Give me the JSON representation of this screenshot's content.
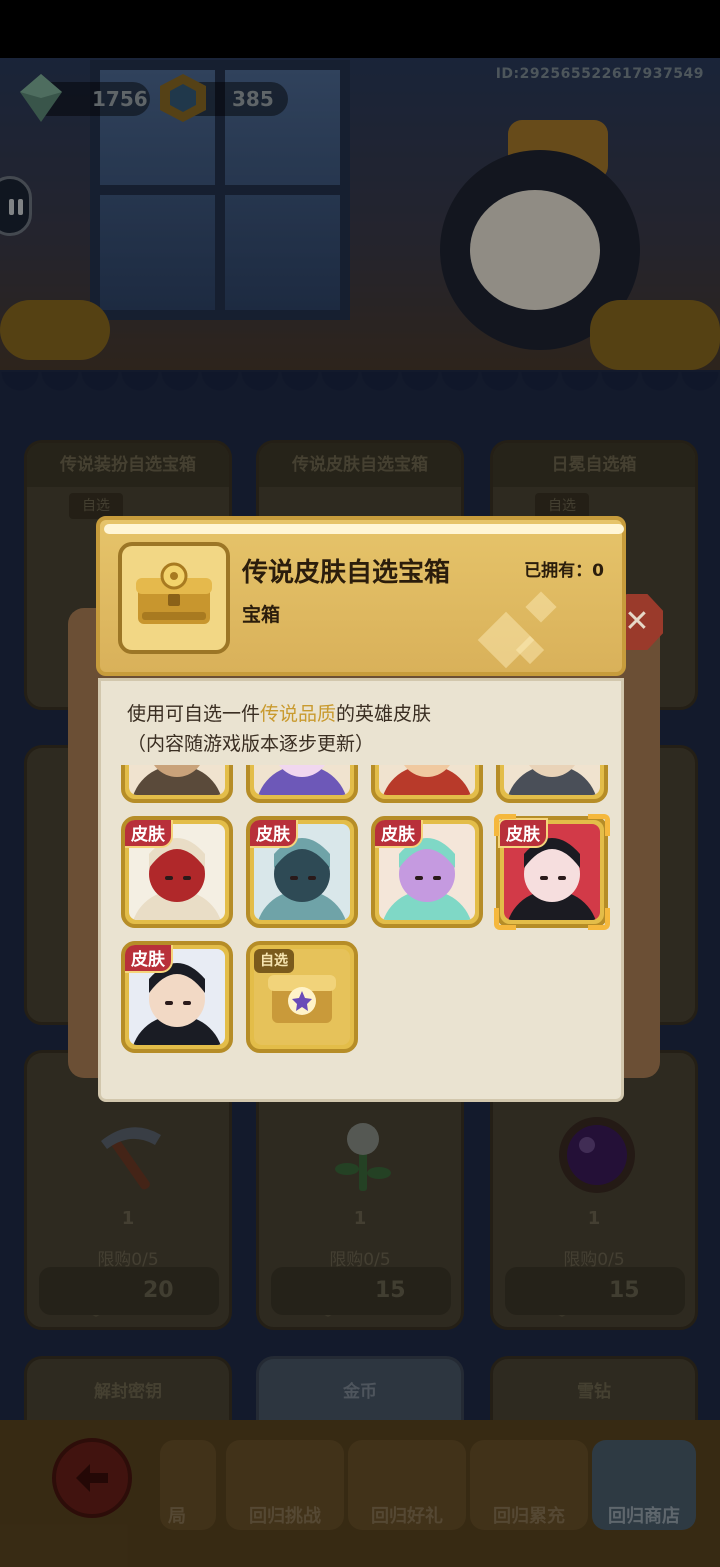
{
  "status": {
    "gems": "1756",
    "cubes": "385",
    "player_id": "ID:2925655226179375​49"
  },
  "shop": {
    "cards": [
      {
        "title": "传说装扮自选宝箱",
        "tag": "自选"
      },
      {
        "title": "传说皮肤自选宝箱",
        "tag": ""
      },
      {
        "title": "日冕自选箱",
        "tag": "自选"
      }
    ],
    "buy_items": [
      {
        "qty": "1",
        "limit": "限购0/5",
        "price": "20",
        "icon": "pickaxe-icon"
      },
      {
        "qty": "1",
        "limit": "限购0/5",
        "price": "15",
        "icon": "plant-icon"
      },
      {
        "qty": "1",
        "limit": "限购0/5",
        "price": "15",
        "icon": "purple-orb-icon"
      }
    ],
    "section_headers": [
      "解封密钥",
      "金币",
      "雪钻"
    ]
  },
  "bottom_nav": {
    "partial_label": "局",
    "items": [
      "回归挑战",
      "回归好礼",
      "回归累充",
      "回归商店"
    ]
  },
  "modal": {
    "title": "传说皮肤自选宝箱",
    "subtitle": "宝箱",
    "owned_label": "已拥有：",
    "owned_count": "0",
    "desc_prefix": "使用可自选一件",
    "desc_highlight": "传说品质",
    "desc_suffix": "的英雄皮肤",
    "desc_line2": "（内容随游戏版本逐步更新）",
    "skin_tag": "皮肤",
    "pick_tag": "自选",
    "tiles": [
      {
        "kind": "partial",
        "palette": [
          "#5a4a3a",
          "#c9a27a"
        ]
      },
      {
        "kind": "partial",
        "palette": [
          "#6d58b8",
          "#f1d7ef"
        ]
      },
      {
        "kind": "partial",
        "palette": [
          "#b83a2a",
          "#f0c9a0"
        ]
      },
      {
        "kind": "partial",
        "palette": [
          "#4a4f58",
          "#e9d3b8"
        ]
      },
      {
        "kind": "skin",
        "name": "monkey-king-skin",
        "palette": [
          "#e9ddc6",
          "#b0282a",
          "#f4efe3"
        ]
      },
      {
        "kind": "skin",
        "name": "armored-dragon-skin",
        "palette": [
          "#6fa3a8",
          "#2e4a55",
          "#d9e7ea"
        ]
      },
      {
        "kind": "skin",
        "name": "teal-hair-girl-skin",
        "palette": [
          "#7fd8c6",
          "#c59ae0",
          "#f4e6d9"
        ]
      },
      {
        "kind": "skin",
        "name": "black-hair-shrine-skin",
        "palette": [
          "#1b1b22",
          "#f6dede",
          "#d23a48"
        ],
        "selected": true
      },
      {
        "kind": "skin",
        "name": "swordsman-skin",
        "palette": [
          "#1a1c24",
          "#f2d9c5",
          "#e8ecf4"
        ]
      },
      {
        "kind": "pick",
        "name": "choice-chest",
        "palette": [
          "#c99a3a",
          "#6a4bb8"
        ]
      }
    ]
  },
  "colors": {
    "modal_header": "#e6c46a",
    "modal_body": "#eae3d1",
    "highlight_text": "#c99a2e",
    "skin_tag": "#b8303a",
    "tile_gold": "#e3bd49"
  }
}
